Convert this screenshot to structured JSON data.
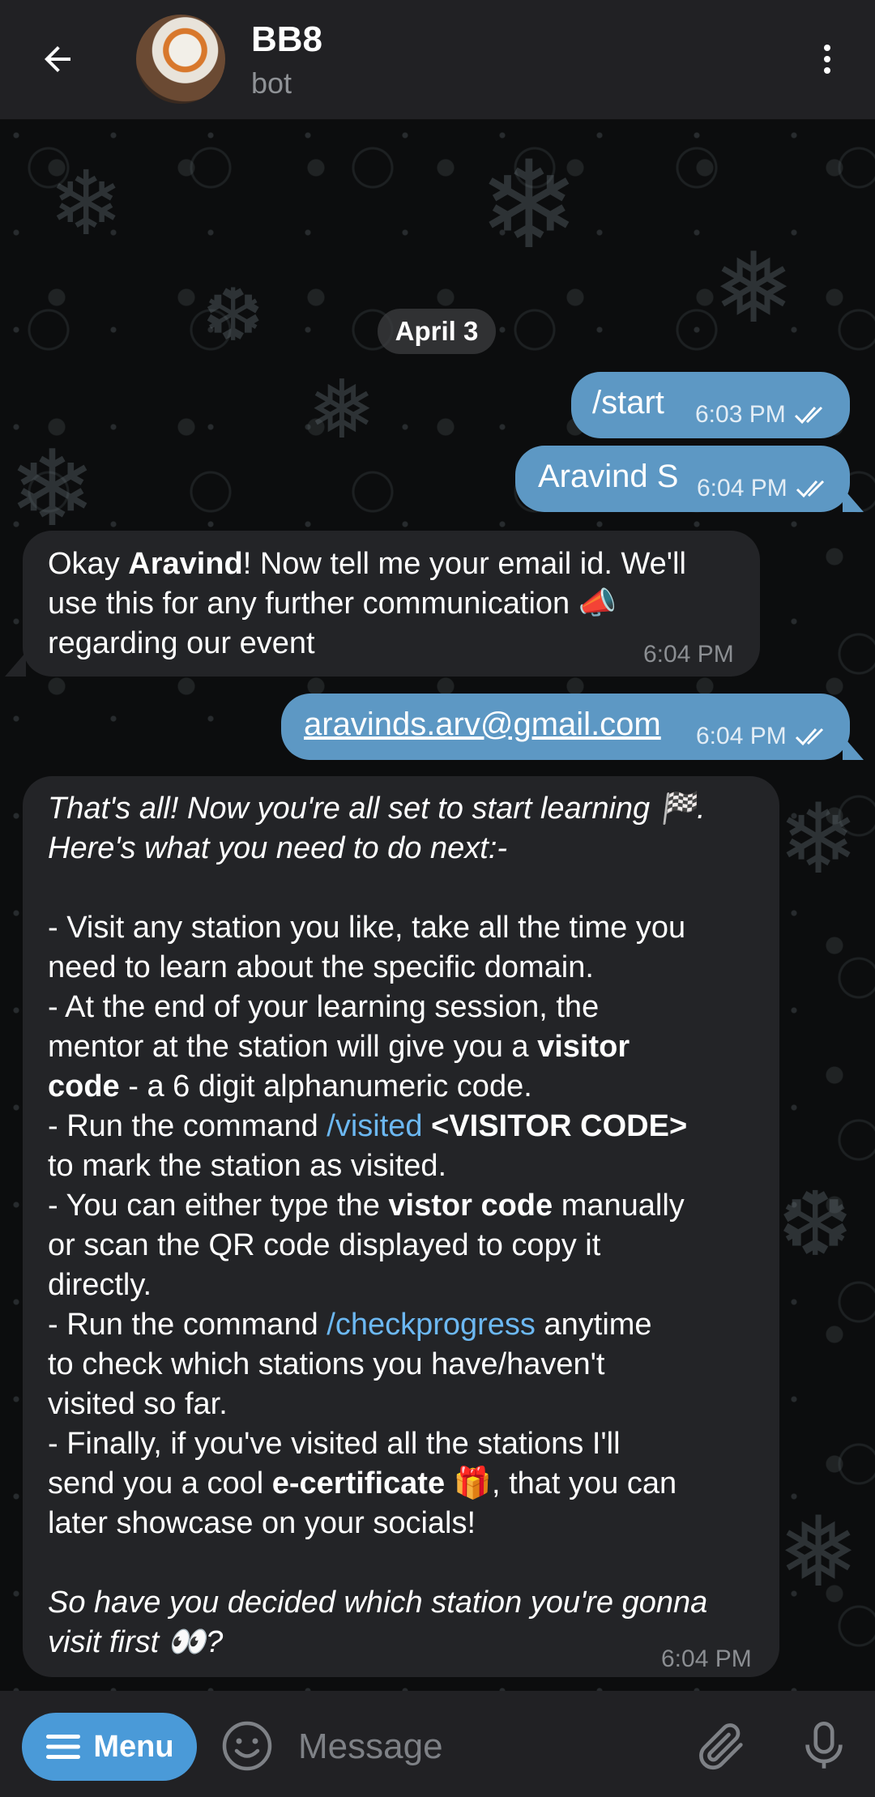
{
  "header": {
    "title": "BB8",
    "subtitle": "bot",
    "back_icon": "arrow-left-icon",
    "more_icon": "more-vertical-icon"
  },
  "chat": {
    "date_label": "April 3",
    "messages": [
      {
        "text": "/start",
        "time": "6:03 PM",
        "status": "read"
      },
      {
        "text": "Aravind S",
        "time": "6:04 PM",
        "status": "read"
      },
      {
        "parts": {
          "p1": "Okay ",
          "p2": "Aravind",
          "p3": "! Now tell me your email id. We'll",
          "l2": "use this for any further communication 📣",
          "l3": "regarding our event"
        },
        "time": "6:04 PM"
      },
      {
        "text": "aravinds.arv@gmail.com",
        "time": "6:04 PM",
        "status": "read"
      },
      {
        "parts": {
          "l1": "That's all! Now you're all set to start learning 🏁.",
          "l2": "Here's what you need to do next:-",
          "l3": "- Visit any station you like, take all the time you",
          "l4": "need to learn about the specific domain.",
          "l5": "- At the end of your learning session, the",
          "l6a": "mentor at the station will give you a ",
          "l6b": "visitor",
          "l7a": "code",
          "l7b": " - a 6 digit alphanumeric code.",
          "l8a": "- Run the command ",
          "l8b": "/visited",
          "l8c": " <VISITOR CODE>",
          "l9": "to mark the station as visited.",
          "l10a": "- You can either type the ",
          "l10b": "vistor code",
          "l10c": " manually",
          "l11": "or scan the QR code displayed to copy it",
          "l12": "directly.",
          "l13a": "- Run the command ",
          "l13b": "/checkprogress",
          "l13c": " anytime",
          "l14": "to check which stations you have/haven't",
          "l15": "visited so far.",
          "l16": "- Finally, if you've visited all the stations I'll",
          "l17a": "send you a cool ",
          "l17b": "e-certificate",
          "l17c": " 🎁, that you can",
          "l18": "later showcase on your socials!",
          "l19": "So have you decided which station you're gonna",
          "l20": "visit first 👀?"
        },
        "time": "6:04 PM"
      }
    ]
  },
  "input": {
    "menu_label": "Menu",
    "placeholder": "Message",
    "emoji_icon": "smile-icon",
    "attach_icon": "paperclip-icon",
    "mic_icon": "microphone-icon"
  },
  "colors": {
    "outgoing_bubble": "#5d98c4",
    "incoming_bubble": "#232427",
    "accent": "#4a9ad8",
    "link": "#6cb8f2"
  }
}
